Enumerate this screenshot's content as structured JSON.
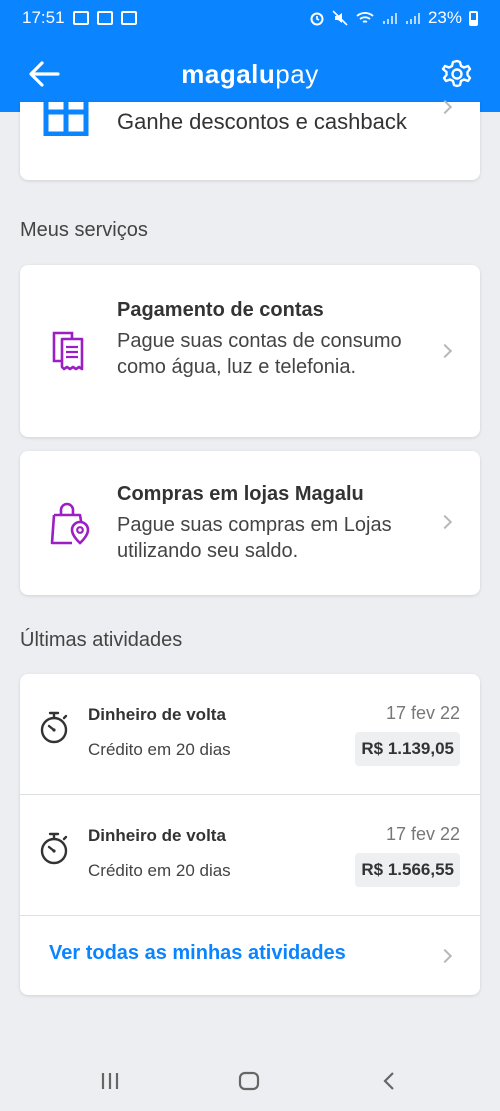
{
  "status_bar": {
    "time": "17:51",
    "battery": "23%"
  },
  "header": {
    "logo_brand": "magalu",
    "logo_suffix": "pay"
  },
  "promo": {
    "label": "Ganhe descontos e cashback"
  },
  "services": {
    "title": "Meus serviços",
    "items": [
      {
        "title": "Pagamento de contas",
        "description": "Pague suas contas de consumo como água, luz e telefonia."
      },
      {
        "title": "Compras em lojas Magalu",
        "description": "Pague suas compras em Lojas utilizando seu saldo."
      }
    ]
  },
  "activities": {
    "title": "Últimas atividades",
    "items": [
      {
        "name": "Dinheiro de volta",
        "subtitle": "Crédito em 20 dias",
        "date": "17 fev 22",
        "amount": "R$ 1.139,05"
      },
      {
        "name": "Dinheiro de volta",
        "subtitle": "Crédito em 20 dias",
        "date": "17 fev 22",
        "amount": "R$ 1.566,55"
      }
    ],
    "see_all": "Ver todas as minhas atividades"
  },
  "colors": {
    "primary": "#0a84ff",
    "icon_purple": "#9b1fc4",
    "background": "#eceef1"
  }
}
